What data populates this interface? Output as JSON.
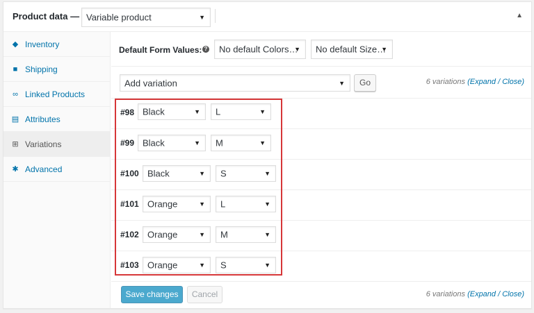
{
  "header": {
    "title": "Product data —",
    "product_type": "Variable product",
    "toggle_icon": "triangle-up-icon"
  },
  "sidebar": {
    "items": [
      {
        "label": "Inventory",
        "icon": "tag-icon"
      },
      {
        "label": "Shipping",
        "icon": "truck-icon"
      },
      {
        "label": "Linked Products",
        "icon": "link-icon"
      },
      {
        "label": "Attributes",
        "icon": "list-icon"
      },
      {
        "label": "Variations",
        "icon": "grid-icon",
        "active": true
      },
      {
        "label": "Advanced",
        "icon": "gear-icon"
      }
    ]
  },
  "default_form": {
    "label": "Default Form Values:",
    "colors_value": "No default Colors…",
    "size_value": "No default Size…"
  },
  "add_variation": {
    "select_value": "Add variation",
    "go_label": "Go",
    "count_text": "6 variations",
    "expand_close": "(Expand / Close)"
  },
  "variations": [
    {
      "id": "#98",
      "color": "Black",
      "size": "L"
    },
    {
      "id": "#99",
      "color": "Black",
      "size": "M"
    },
    {
      "id": "#100",
      "color": "Black",
      "size": "S"
    },
    {
      "id": "#101",
      "color": "Orange",
      "size": "L"
    },
    {
      "id": "#102",
      "color": "Orange",
      "size": "M"
    },
    {
      "id": "#103",
      "color": "Orange",
      "size": "S"
    }
  ],
  "footer": {
    "save_label": "Save changes",
    "cancel_label": "Cancel",
    "count_text": "6 variations",
    "expand_close": "(Expand / Close)"
  },
  "colors": {
    "accent": "#0073aa",
    "highlight_border": "#d63638",
    "save_button": "#0085ba"
  }
}
